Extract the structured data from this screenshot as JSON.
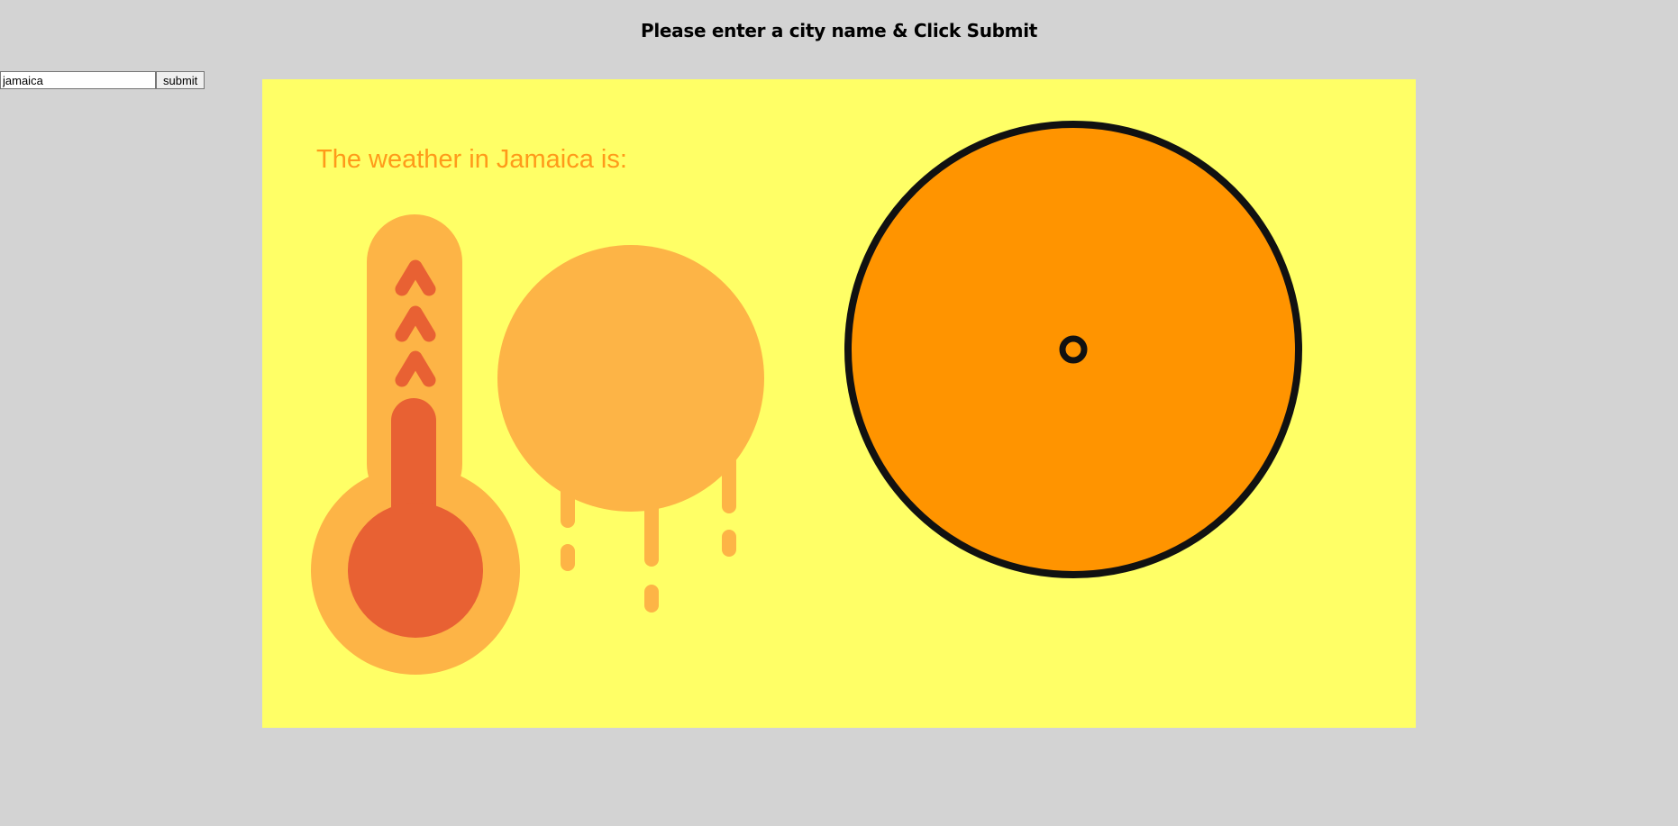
{
  "header": {
    "title": "Please enter a city name & Click Submit"
  },
  "form": {
    "city_value": "jamaica",
    "submit_label": "submit"
  },
  "weather": {
    "message": "The weather in Jamaica is:",
    "icons": [
      "hot-thermometer-icon",
      "melting-sun-icon",
      "orange-dial-icon"
    ]
  },
  "colors": {
    "page_background": "#d3d3d3",
    "panel_background": "#ffff66",
    "text_orange": "#ff9a1a",
    "light_orange": "#fdb446",
    "red_orange": "#e86133",
    "dial_orange": "#ff9400",
    "dial_outline": "#111111"
  }
}
